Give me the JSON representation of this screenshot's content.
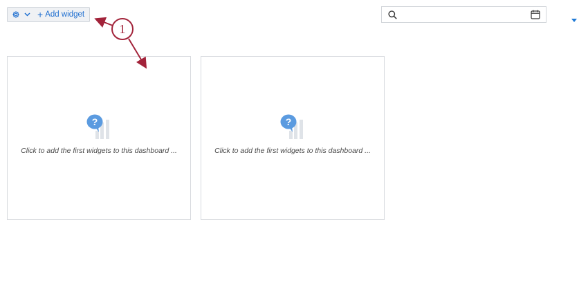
{
  "toolbar": {
    "gear_icon": "gear-icon",
    "chevron_icon": "chevron-down-icon",
    "add_widget_label": "Add widget",
    "plus_glyph": "+"
  },
  "search": {
    "value": "",
    "search_icon": "search-icon",
    "calendar_icon": "calendar-icon"
  },
  "dropdown": {
    "icon": "caret-down-icon"
  },
  "widgets": [
    {
      "message": "Click to add the first widgets to this dashboard ..."
    },
    {
      "message": "Click to add the first widgets to this dashboard ..."
    }
  ],
  "annotation": {
    "number": "1",
    "color": "#a2233a"
  },
  "colors": {
    "accent_blue": "#1f6fd0",
    "icon_blue": "#5b9be0",
    "icon_grey": "#dfe3e8",
    "caret_blue": "#1f7ad6"
  }
}
